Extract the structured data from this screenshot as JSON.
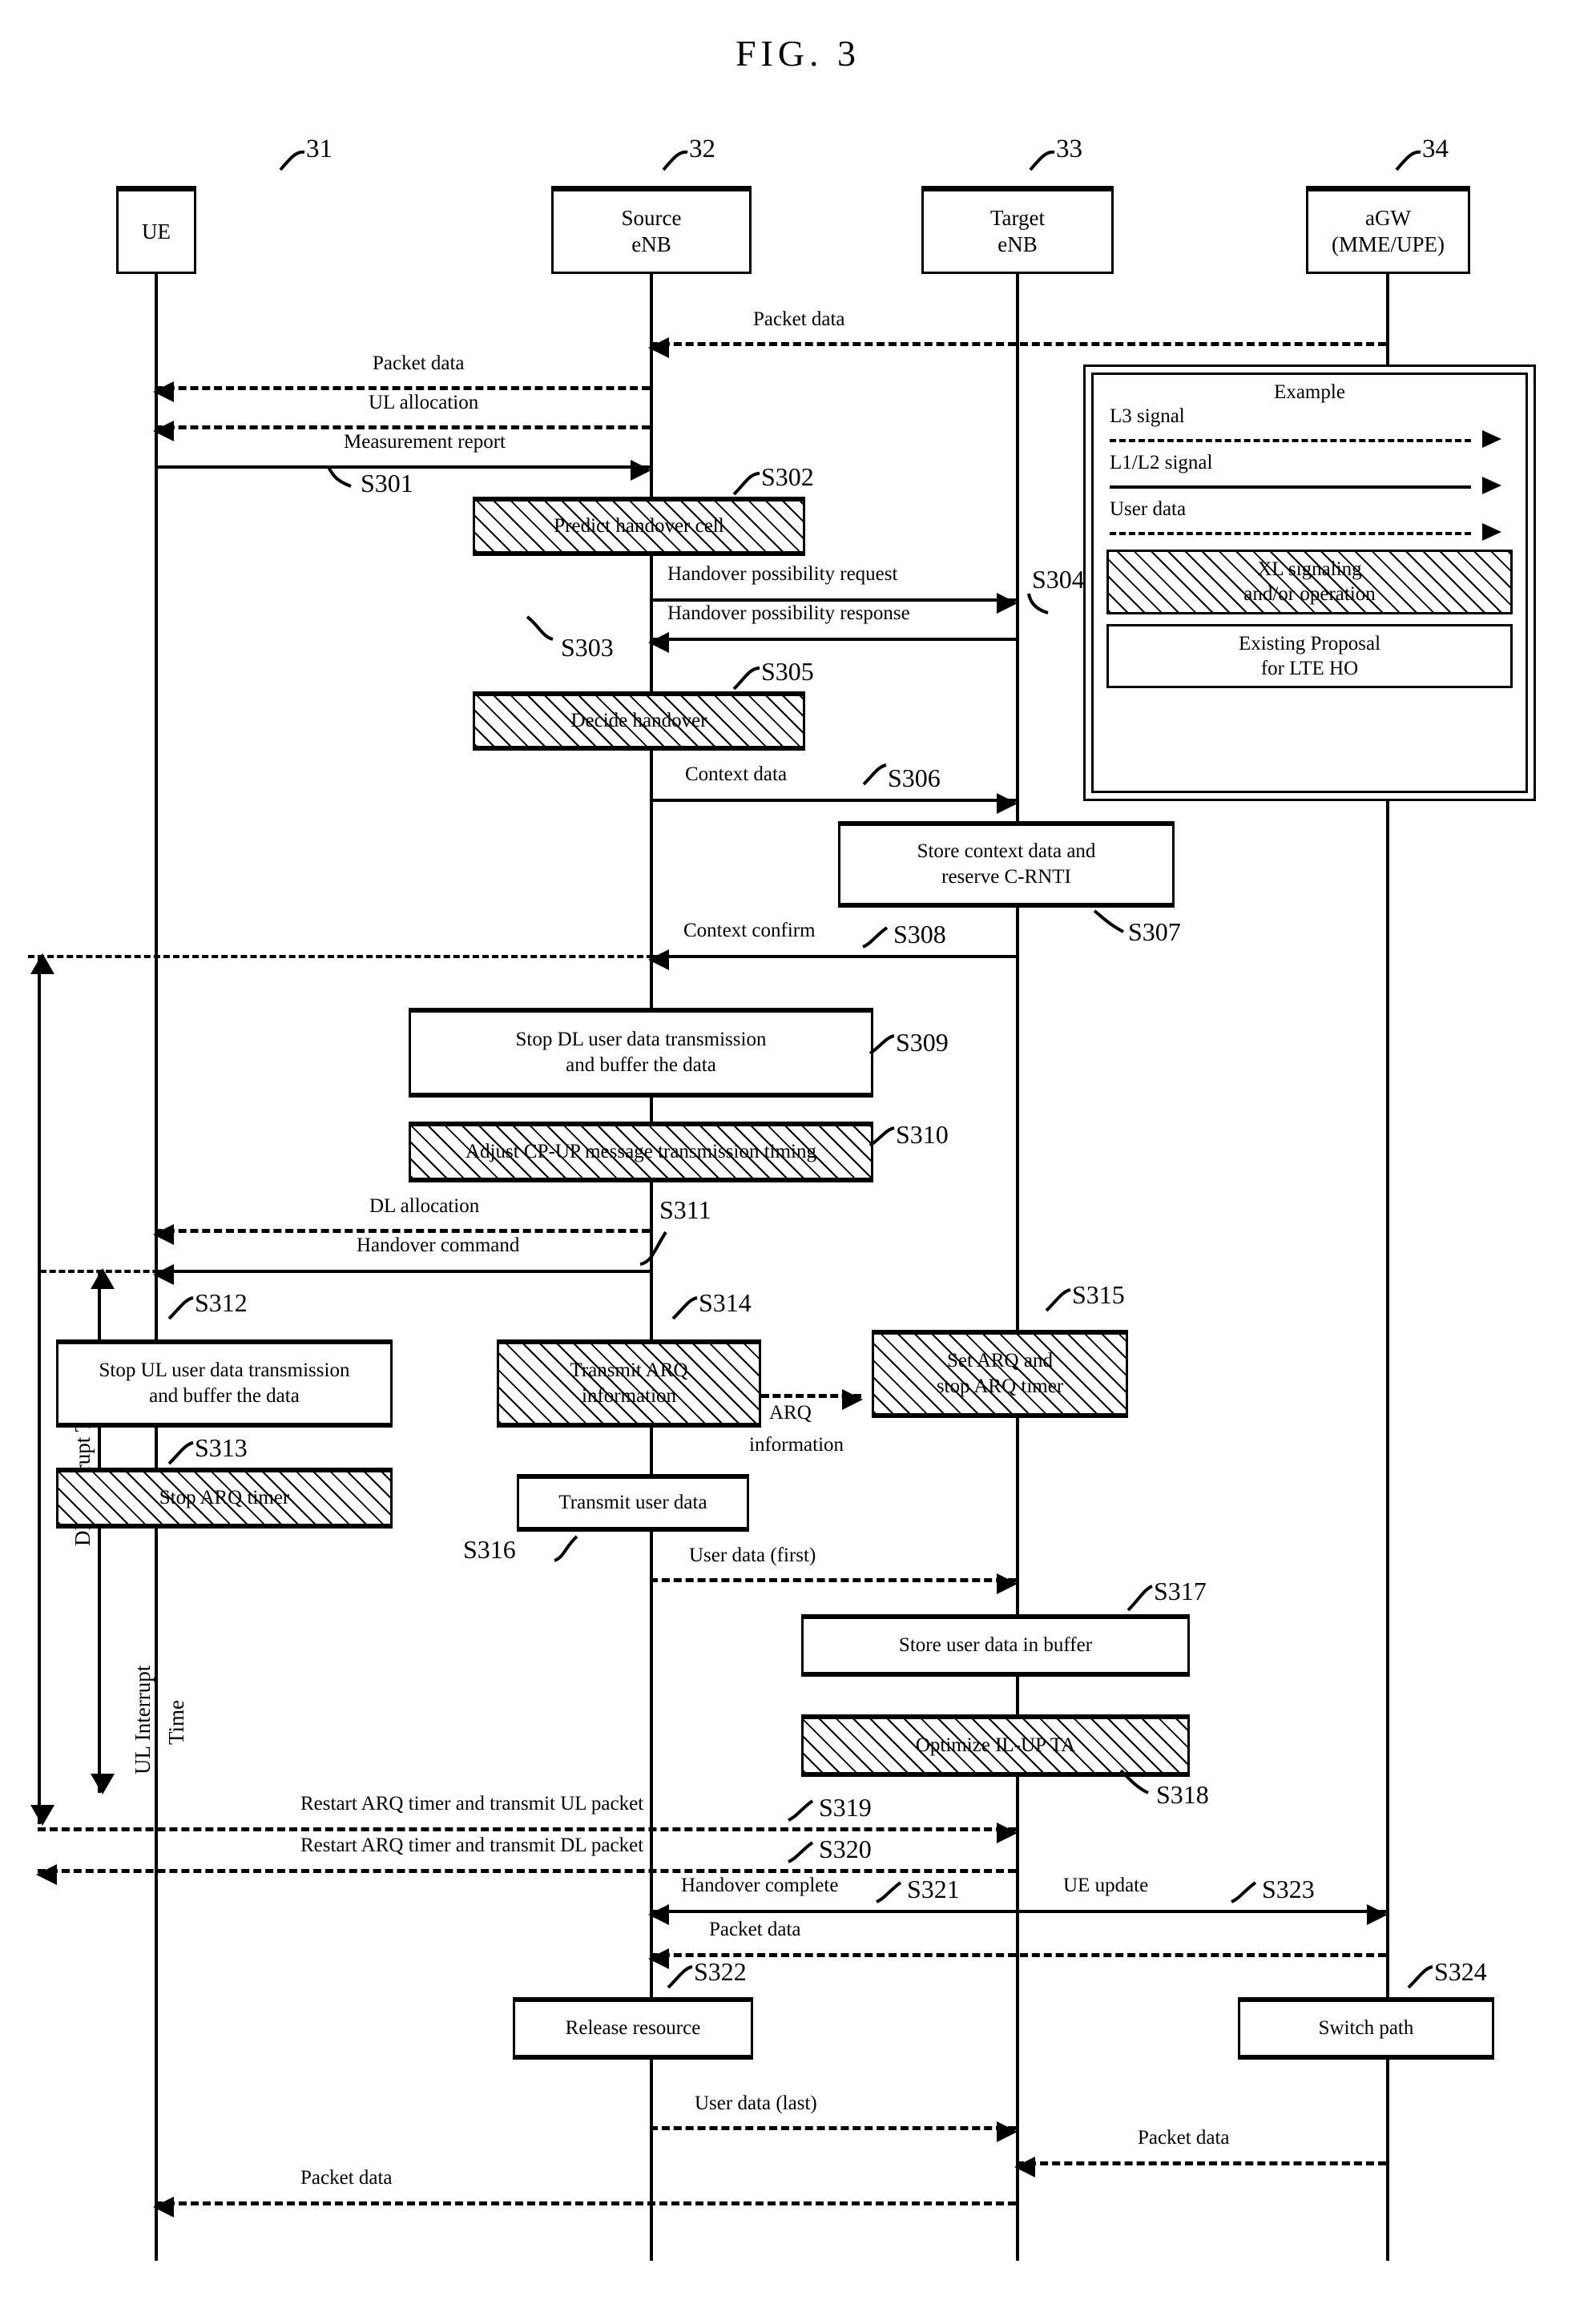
{
  "figure": {
    "title": "FIG.  3"
  },
  "nodes": [
    {
      "ref": "31",
      "label": "UE",
      "label2": ""
    },
    {
      "ref": "32",
      "label": "Source",
      "label2": "eNB"
    },
    {
      "ref": "33",
      "label": "Target",
      "label2": "eNB"
    },
    {
      "ref": "34",
      "label": "aGW",
      "label2": "(MME/UPE)"
    }
  ],
  "legend": {
    "title": "Example",
    "rows": [
      {
        "label": "L3 signal",
        "style": "solid-dash"
      },
      {
        "label": "L1/L2 signal",
        "style": "solid"
      },
      {
        "label": "User data",
        "style": "dashed"
      }
    ],
    "sub_hatched": "XL signaling\nand/or operation",
    "sub_hatched_line1": "XL signaling",
    "sub_hatched_line2": "and/or operation",
    "sub_plain_line1": "Existing Proposal",
    "sub_plain_line2": "for LTE HO"
  },
  "messages": {
    "m_packet_data_top": "Packet data",
    "m_packet_data_ue": "Packet data",
    "m_ul_allocation": "UL allocation",
    "m_measurement_report": "Measurement report",
    "m_ho_poss_request": "Handover possibility request",
    "m_ho_poss_response": "Handover possibility response",
    "m_context_data": "Context data",
    "m_context_confirm": "Context confirm",
    "m_dl_allocation": "DL allocation",
    "m_handover_command": "Handover command",
    "m_arq_information_1": "ARQ",
    "m_arq_information_2": "information",
    "m_user_data_first": "User data (first)",
    "m_restart_ul": "Restart ARQ timer and transmit UL packet",
    "m_restart_dl": "Restart ARQ timer and transmit DL packet",
    "m_handover_complete": "Handover complete",
    "m_ue_update": "UE update",
    "m_packet_data_mid": "Packet data",
    "m_user_data_last": "User data (last)",
    "m_packet_data_agw": "Packet data",
    "m_packet_data_bottom": "Packet data"
  },
  "processes": {
    "p302": "Predict handover cell",
    "p305": "Decide handover",
    "p307_l1": "Store context data and",
    "p307_l2": "reserve C-RNTI",
    "p309_l1": "Stop DL user data transmission",
    "p309_l2": "and buffer the data",
    "p310": "Adjust CP-UP message transmission timing",
    "p312_l1": "Stop UL user data transmission",
    "p312_l2": "and buffer the data",
    "p313": "Stop ARQ timer",
    "p314_l1": "Transmit ARQ",
    "p314_l2": "information",
    "p315_l1": "Set ARQ and",
    "p315_l2": "stop ARQ timer",
    "p316": "Transmit user data",
    "p317": "Store user data in buffer",
    "p318": "Optimize IL-UP TA",
    "p322": "Release resource",
    "p324": "Switch path"
  },
  "steps": {
    "s301": "S301",
    "s302": "S302",
    "s303": "S303",
    "s304": "S304",
    "s305": "S305",
    "s306": "S306",
    "s307": "S307",
    "s308": "S308",
    "s309": "S309",
    "s310": "S310",
    "s311": "S311",
    "s312": "S312",
    "s313": "S313",
    "s314": "S314",
    "s315": "S315",
    "s316": "S316",
    "s317": "S317",
    "s318": "S318",
    "s319": "S319",
    "s320": "S320",
    "s321": "S321",
    "s322": "S322",
    "s323": "S323",
    "s324": "S324"
  },
  "measures": {
    "dl_interrupt": "DL Interrupt Time",
    "ul_interrupt_1": "UL Interrupt",
    "ul_interrupt_2": "Time"
  }
}
